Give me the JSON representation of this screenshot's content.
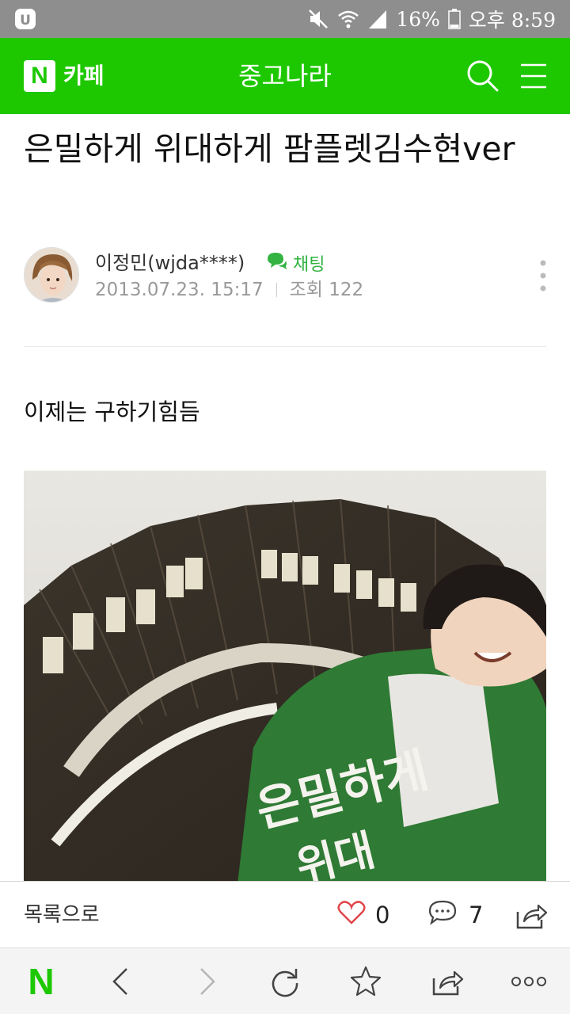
{
  "status_bar": {
    "battery": "16%",
    "time": "오후 8:59",
    "icons": [
      "carrier-logo-icon",
      "mute-icon",
      "wifi-icon",
      "signal-icon",
      "battery-icon"
    ]
  },
  "app_bar": {
    "logo_letter": "N",
    "service": "카페",
    "title": "중고나라",
    "icons": [
      "search-icon",
      "menu-icon"
    ]
  },
  "article": {
    "title": "은밀하게 위대하게 팜플렛김수현ver",
    "author": "이정민(wjda****)",
    "chat_label": "채팅",
    "date": "2013.07.23. 15:17",
    "views": "조회 122",
    "body": "이제는 구하기힘듬"
  },
  "action_bar": {
    "list_label": "목록으로",
    "likes": "0",
    "comments": "7",
    "icons": [
      "heart-icon",
      "comment-icon",
      "share-icon"
    ]
  },
  "nav_bar": {
    "logo_letter": "N",
    "icons": [
      "back-icon",
      "forward-icon",
      "refresh-icon",
      "bookmark-star-icon",
      "share-icon",
      "more-icon"
    ]
  },
  "colors": {
    "naver_green": "#1ec800",
    "status_bar": "#8e8e8e",
    "chat_green": "#33b342",
    "like_red": "#e0474c"
  }
}
